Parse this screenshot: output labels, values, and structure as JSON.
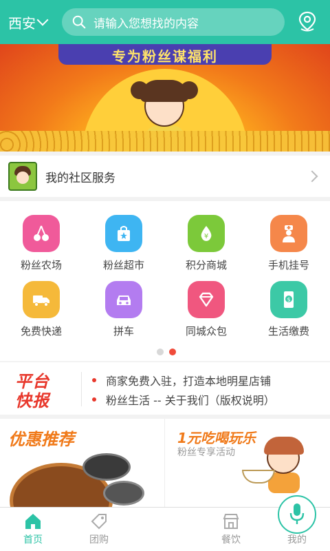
{
  "header": {
    "city": "西安",
    "search_placeholder": "请输入您想找的内容"
  },
  "banner": {
    "title": "专为粉丝谋福利"
  },
  "community": {
    "label": "我的社区服务"
  },
  "grid": {
    "items": [
      {
        "label": "粉丝农场",
        "icon": "cherry-icon",
        "color": "#f05a9a"
      },
      {
        "label": "粉丝超市",
        "icon": "shopping-bag-icon",
        "color": "#3eb5f2"
      },
      {
        "label": "积分商城",
        "icon": "money-drop-icon",
        "color": "#7cc93a"
      },
      {
        "label": "手机挂号",
        "icon": "doctor-icon",
        "color": "#f5874a"
      },
      {
        "label": "免费快递",
        "icon": "delivery-icon",
        "color": "#f5b93a"
      },
      {
        "label": "拼车",
        "icon": "car-icon",
        "color": "#b37cf0"
      },
      {
        "label": "同城众包",
        "icon": "diamond-icon",
        "color": "#f0577f"
      },
      {
        "label": "生活缴费",
        "icon": "payment-icon",
        "color": "#3cc9a6"
      }
    ],
    "page_dots": {
      "total": 2,
      "active": 2
    }
  },
  "news": {
    "logo_line1": "平台",
    "logo_line2": "快报",
    "items": [
      "商家免费入驻，打造本地明星店铺",
      "粉丝生活 -- 关于我们（版权说明）"
    ]
  },
  "promo": {
    "left_title": "优惠推荐",
    "right_title": "1元吃喝玩乐",
    "right_subtitle": "粉丝专享活动"
  },
  "bottom_nav": {
    "items": [
      {
        "label": "首页",
        "icon": "home-icon",
        "active": true
      },
      {
        "label": "团购",
        "icon": "tag-icon",
        "active": false
      },
      {
        "label": "",
        "icon": "microphone-icon",
        "active": false
      },
      {
        "label": "餐饮",
        "icon": "store-icon",
        "active": false
      },
      {
        "label": "我的",
        "icon": "user-icon",
        "active": false
      }
    ]
  },
  "colors": {
    "accent": "#2cc3a6",
    "news_red": "#e8382c",
    "promo_orange": "#f07a1a"
  }
}
